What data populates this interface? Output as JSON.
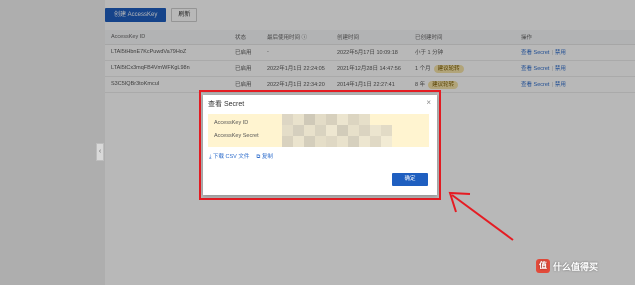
{
  "toolbar": {
    "create_label": "创建 AccessKey",
    "refresh_label": "刷新"
  },
  "table": {
    "headers": [
      "AccessKey ID",
      "状态",
      "最后使用时间 ⓘ",
      "创建时间",
      "已创建时间",
      "操作"
    ],
    "rows": [
      {
        "id": "LTAI5tHbnE7KcPuwdVa79HoZ",
        "status": "已启用",
        "last_used": "-",
        "created": "2022年5月17日 10:09:18",
        "age": "小于 1 分钟",
        "tag": "",
        "action_view": "查看 Secret",
        "action_disable": "禁用"
      },
      {
        "id": "LTAI5tCx3mqFB4VmWFKgL98n",
        "status": "已启用",
        "last_used": "2022年1月1日 22:24:05",
        "created": "2021年12月28日 14:47:56",
        "age": "1 个月",
        "tag": "建议轮转",
        "action_view": "查看 Secret",
        "action_disable": "禁用"
      },
      {
        "id": "S3C5IQBr3toKmcuI",
        "status": "已启用",
        "last_used": "2022年1月1日 22:34:20",
        "created": "2014年1月1日 22:27:41",
        "age": "8 年",
        "tag": "建议轮转",
        "action_view": "查看 Secret",
        "action_disable": "禁用"
      }
    ]
  },
  "modal": {
    "title": "查看 Secret",
    "close_icon": "×",
    "labels": {
      "id": "AccessKey ID",
      "secret": "AccessKey Secret"
    },
    "download_label": "下载 CSV 文件",
    "copy_label": "复制",
    "ok_label": "确定"
  },
  "watermark": {
    "text": "什么值得买",
    "logo": "值"
  },
  "colors": {
    "primary": "#1f5fc0",
    "highlight_frame": "#e51c23",
    "arrow": "#e51c23",
    "panel": "#fff4d0"
  },
  "icons": {
    "collapse": "‹",
    "download": "⤓",
    "copy": "⧉"
  }
}
